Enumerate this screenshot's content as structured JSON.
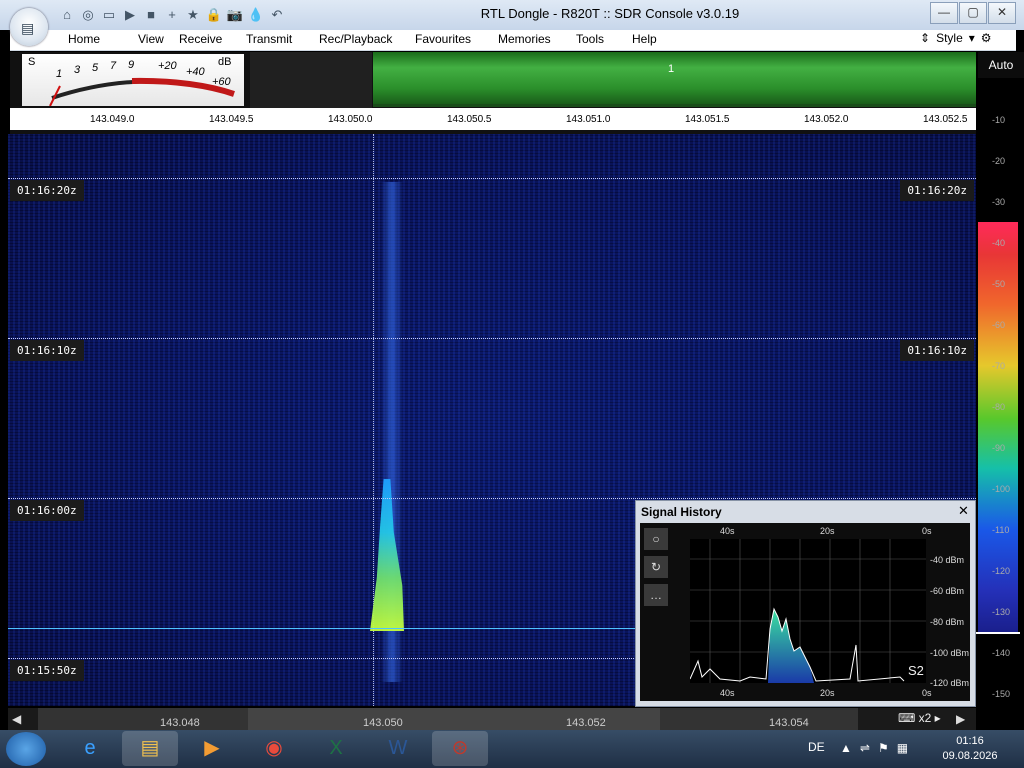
{
  "window": {
    "title": "RTL Dongle - R820T :: SDR Console v3.0.19",
    "controls": [
      "—",
      "▢",
      "✕"
    ]
  },
  "quick_access": [
    {
      "icon": "home-icon",
      "glyph": "⌂"
    },
    {
      "icon": "lifebuoy-icon",
      "glyph": "◎"
    },
    {
      "icon": "folder-icon",
      "glyph": "▭"
    },
    {
      "icon": "play-icon",
      "glyph": "▶"
    },
    {
      "icon": "stop-icon",
      "glyph": "■"
    },
    {
      "icon": "plus-icon",
      "glyph": "+"
    },
    {
      "icon": "star-icon",
      "glyph": "★"
    },
    {
      "icon": "lock-icon",
      "glyph": "🔒"
    },
    {
      "icon": "camera-icon",
      "glyph": "📷"
    },
    {
      "icon": "drop-icon",
      "glyph": "💧"
    },
    {
      "icon": "undo-icon",
      "glyph": "↶"
    }
  ],
  "menu": [
    "Home",
    "View",
    "Receive",
    "Transmit",
    "Rec/Playback",
    "Favourites",
    "Memories",
    "Tools",
    "Help"
  ],
  "style_label": "Style",
  "smeter": {
    "s_label": "S",
    "db_label": "dB",
    "ticks": [
      "1",
      "3",
      "5",
      "7",
      "9",
      "+20",
      "+40",
      "+60"
    ]
  },
  "channel_label": "1",
  "auto_button": "Auto",
  "freq_scale": [
    "143.049.0",
    "143.049.5",
    "143.050.0",
    "143.050.5",
    "143.051.0",
    "143.051.5",
    "143.052.0",
    "143.052.5"
  ],
  "time_labels": [
    "01:16:20z",
    "01:16:10z",
    "01:16:00z",
    "01:15:50z"
  ],
  "db_scale": [
    "-10",
    "-20",
    "-30",
    "-40",
    "-50",
    "-60",
    "-70",
    "-80",
    "-90",
    "-100",
    "-110",
    "-120",
    "-130",
    "-140",
    "-150"
  ],
  "bottom_scale": [
    "143.048",
    "143.050",
    "143.052",
    "143.054"
  ],
  "zoom_value": "x2",
  "signal_history": {
    "title": "Signal History",
    "top_axis": [
      "40s",
      "20s",
      "0s"
    ],
    "bottom_axis": [
      "40s",
      "20s",
      "0s"
    ],
    "db_axis": [
      "-40 dBm",
      "-60 dBm",
      "-80 dBm",
      "-100 dBm",
      "-120 dBm"
    ],
    "s_reading": "S2",
    "buttons": [
      "○",
      "↻",
      "…"
    ]
  },
  "taskbar": {
    "apps": [
      {
        "name": "internet-explorer",
        "glyph": "e",
        "color": "#3aa0ff"
      },
      {
        "name": "file-explorer",
        "glyph": "▤",
        "color": "#f2c14e"
      },
      {
        "name": "media-player",
        "glyph": "▶",
        "color": "#f39c33"
      },
      {
        "name": "chrome",
        "glyph": "◉",
        "color": "#e94b3c"
      },
      {
        "name": "excel",
        "glyph": "X",
        "color": "#1e7145"
      },
      {
        "name": "word",
        "glyph": "W",
        "color": "#2b5797"
      },
      {
        "name": "sdr-console",
        "glyph": "⊛",
        "color": "#c0392b"
      }
    ],
    "language": "DE",
    "time": "01:16",
    "date": "09.08.2026"
  },
  "colors": {
    "waterfall_bg": "#081258",
    "green_band": "#2b8f2b",
    "accent": "#4fc3ff"
  }
}
